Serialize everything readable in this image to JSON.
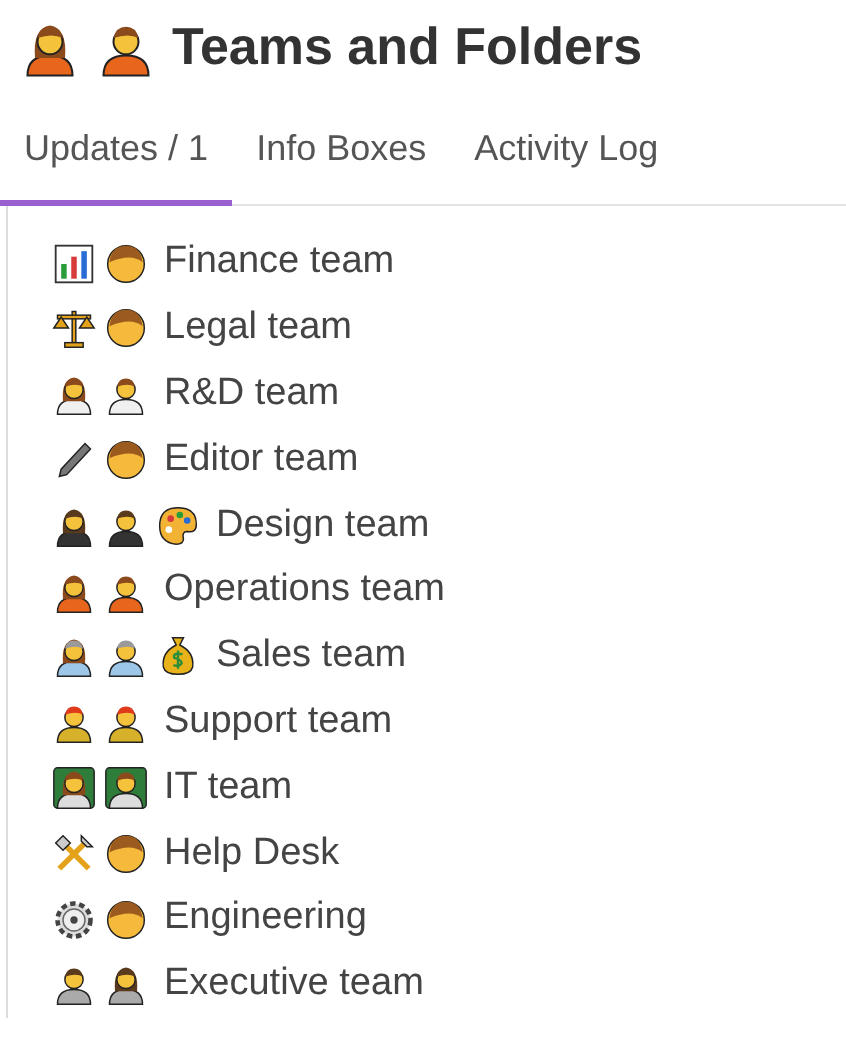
{
  "header": {
    "icons": [
      {
        "kind": "worker-f"
      },
      {
        "kind": "worker-m"
      }
    ],
    "title": "Teams and Folders"
  },
  "tabs": [
    {
      "label": "Updates / 1",
      "selected": true
    },
    {
      "label": "Info Boxes",
      "selected": false
    },
    {
      "label": "Activity Log",
      "selected": false
    }
  ],
  "teams": [
    {
      "label": "Finance team",
      "icons": [
        {
          "kind": "chart"
        },
        {
          "kind": "face"
        }
      ]
    },
    {
      "label": "Legal team",
      "icons": [
        {
          "kind": "scales"
        },
        {
          "kind": "face"
        }
      ]
    },
    {
      "label": "R&D team",
      "icons": [
        {
          "kind": "scientist-f"
        },
        {
          "kind": "scientist-m"
        }
      ]
    },
    {
      "label": "Editor team",
      "icons": [
        {
          "kind": "pen"
        },
        {
          "kind": "face"
        }
      ]
    },
    {
      "label": "Design team",
      "icons": [
        {
          "kind": "artist-f"
        },
        {
          "kind": "artist-m"
        },
        {
          "kind": "palette"
        }
      ]
    },
    {
      "label": "Operations team",
      "icons": [
        {
          "kind": "worker-f"
        },
        {
          "kind": "worker-m"
        }
      ]
    },
    {
      "label": "Sales team",
      "icons": [
        {
          "kind": "welder-f"
        },
        {
          "kind": "welder-m"
        },
        {
          "kind": "moneybag"
        }
      ]
    },
    {
      "label": "Support team",
      "icons": [
        {
          "kind": "firefighter"
        },
        {
          "kind": "firefighter"
        }
      ]
    },
    {
      "label": "IT team",
      "icons": [
        {
          "kind": "techie-f"
        },
        {
          "kind": "techie-m"
        }
      ]
    },
    {
      "label": "Help Desk",
      "icons": [
        {
          "kind": "tools"
        },
        {
          "kind": "face"
        }
      ]
    },
    {
      "label": "Engineering",
      "icons": [
        {
          "kind": "gear"
        },
        {
          "kind": "face"
        }
      ]
    },
    {
      "label": "Executive team",
      "icons": [
        {
          "kind": "office-m"
        },
        {
          "kind": "office-f"
        }
      ]
    }
  ]
}
